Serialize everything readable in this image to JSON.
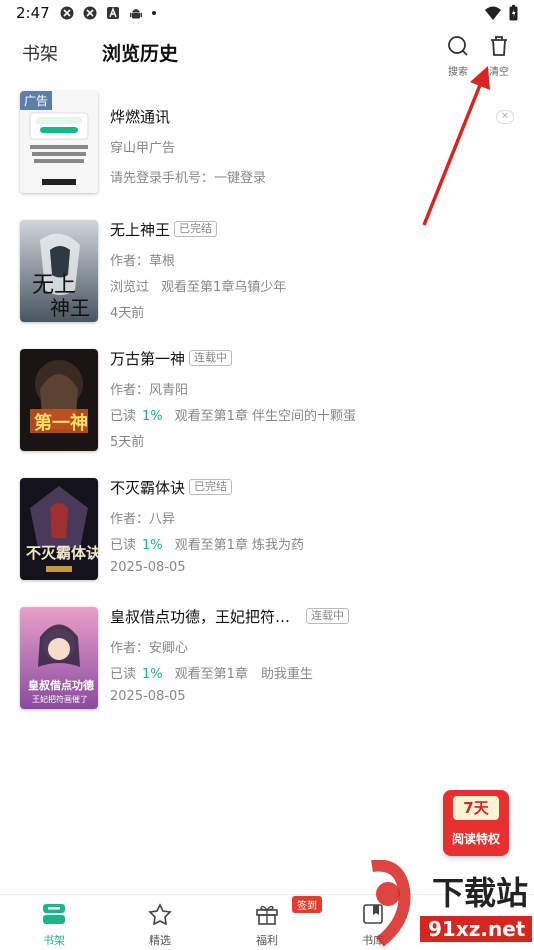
{
  "status_bar": {
    "time": "2:47",
    "icons": [
      "app-icon",
      "app-icon",
      "a-icon",
      "android-icon"
    ],
    "right_icons": [
      "wifi-icon",
      "battery-icon"
    ]
  },
  "header": {
    "tab_shelf": "书架",
    "tab_history": "浏览历史",
    "search_label": "搜索",
    "clear_label": "清空"
  },
  "items": [
    {
      "ad_tag": "广告",
      "title": "烨燃通讯",
      "line1": "穿山甲广告",
      "line2": "请先登录手机号：一键登录",
      "close": "✕"
    },
    {
      "title": "无上神王",
      "badge": "已完结",
      "author": "作者：草根",
      "progress_prefix": "浏览过",
      "progress_text": "观看至第1章乌镇少年",
      "time": "4天前"
    },
    {
      "title": "万古第一神",
      "badge": "连载中",
      "author": "作者：风青阳",
      "progress_prefix": "已读",
      "pct": "1%",
      "progress_text": "观看至第1章 伴生空间的十颗蛋",
      "time": "5天前"
    },
    {
      "title": "不灭霸体诀",
      "badge": "已完结",
      "author": "作者：八异",
      "progress_prefix": "已读",
      "pct": "1%",
      "progress_text": "观看至第1章 炼我为药",
      "time": "2025-08-05"
    },
    {
      "title": "皇叔借点功德，王妃把符…",
      "badge": "连载中",
      "author": "作者：安卿心",
      "progress_prefix": "已读",
      "pct": "1%",
      "progress_text": "观看至第1章　助我重生",
      "time": "2025-08-05"
    }
  ],
  "promo": {
    "top": "7天",
    "bottom": "阅读特权"
  },
  "bottom_nav": [
    {
      "label": "书架",
      "icon": "bookshelf-icon"
    },
    {
      "label": "精选",
      "icon": "star-icon"
    },
    {
      "label": "福利",
      "icon": "gift-icon"
    },
    {
      "label": "书库",
      "icon": "library-icon"
    }
  ],
  "nav_badge": "签到",
  "watermark": {
    "main": "下载站",
    "site": "91xz.net"
  },
  "colors": {
    "accent": "#18b886",
    "arrow": "#d7261f",
    "promo": "#e8312f"
  }
}
